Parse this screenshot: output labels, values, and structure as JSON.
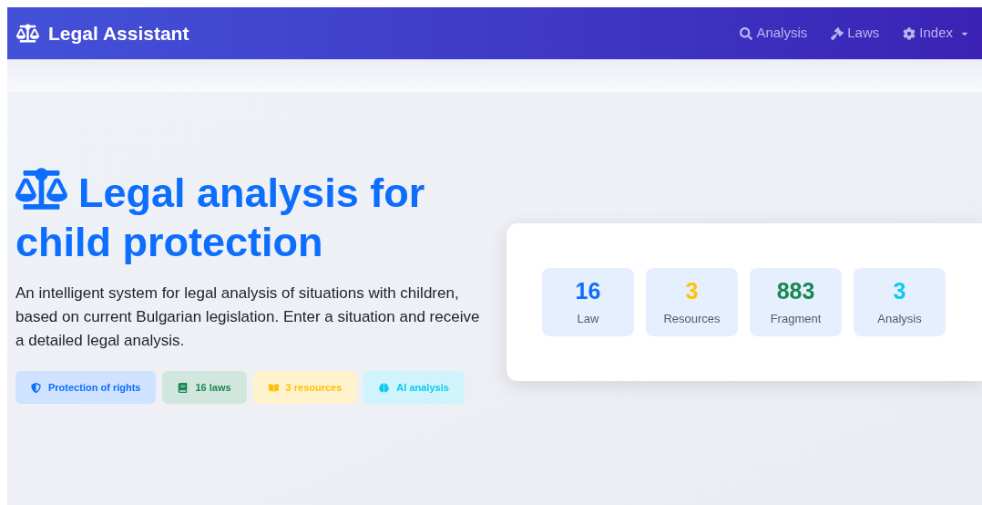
{
  "navbar": {
    "brand": "Legal Assistant",
    "items": [
      {
        "label": "Analysis",
        "kind": "search",
        "dropdown": false
      },
      {
        "label": "Laws",
        "kind": "gavel",
        "dropdown": false
      },
      {
        "label": "Index",
        "kind": "gear",
        "dropdown": true
      }
    ]
  },
  "hero": {
    "title": "Legal analysis for child protection",
    "description": "An intelligent system for legal analysis of situations with children, based on current Bulgarian legislation. Enter a situation and receive a detailed legal analysis.",
    "badges": [
      {
        "label": "Protection of rights",
        "kind": "shield"
      },
      {
        "label": "16 laws",
        "kind": "book"
      },
      {
        "label": "3 resources",
        "kind": "book-open"
      },
      {
        "label": "AI analysis",
        "kind": "brain"
      }
    ]
  },
  "stats": [
    {
      "value": "16",
      "label": "Law",
      "color": "#0d6efd"
    },
    {
      "value": "3",
      "label": "Resources",
      "color": "#ffc107"
    },
    {
      "value": "883",
      "label": "Fragment",
      "color": "#198754"
    },
    {
      "value": "3",
      "label": "Analysis",
      "color": "#0dcaf0"
    }
  ]
}
